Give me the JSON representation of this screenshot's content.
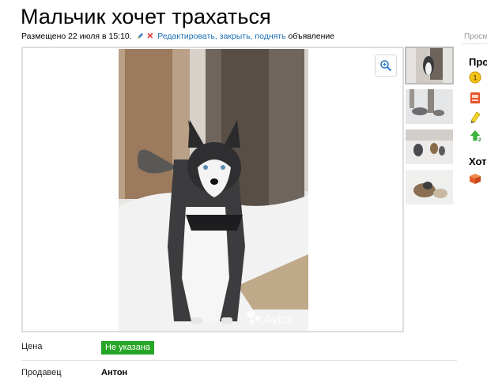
{
  "ad": {
    "title": "Мальчик хочет трахаться",
    "posted": "Размещено 22 июля в 15:10.",
    "actions": "Редактировать, закрыть, поднять",
    "actions_suffix": "объявление"
  },
  "sidebar": {
    "cut_label": "Просм",
    "promote_heading": "Про",
    "want_heading": "Хот"
  },
  "gallery": {
    "watermark": "Avito",
    "thumbnail_count": 4,
    "active_index": 0
  },
  "details": {
    "price_label": "Цена",
    "price_value": "Не указана",
    "seller_label": "Продавец",
    "seller_value": "Антон"
  },
  "colors": {
    "price_badge": "#26a526",
    "link": "#1a6fb5"
  },
  "icons": [
    "pencil-icon",
    "close-icon",
    "zoom-in-icon",
    "coin-icon",
    "vip-icon",
    "highlight-icon",
    "arrow-up-icon",
    "gift-box-icon"
  ]
}
